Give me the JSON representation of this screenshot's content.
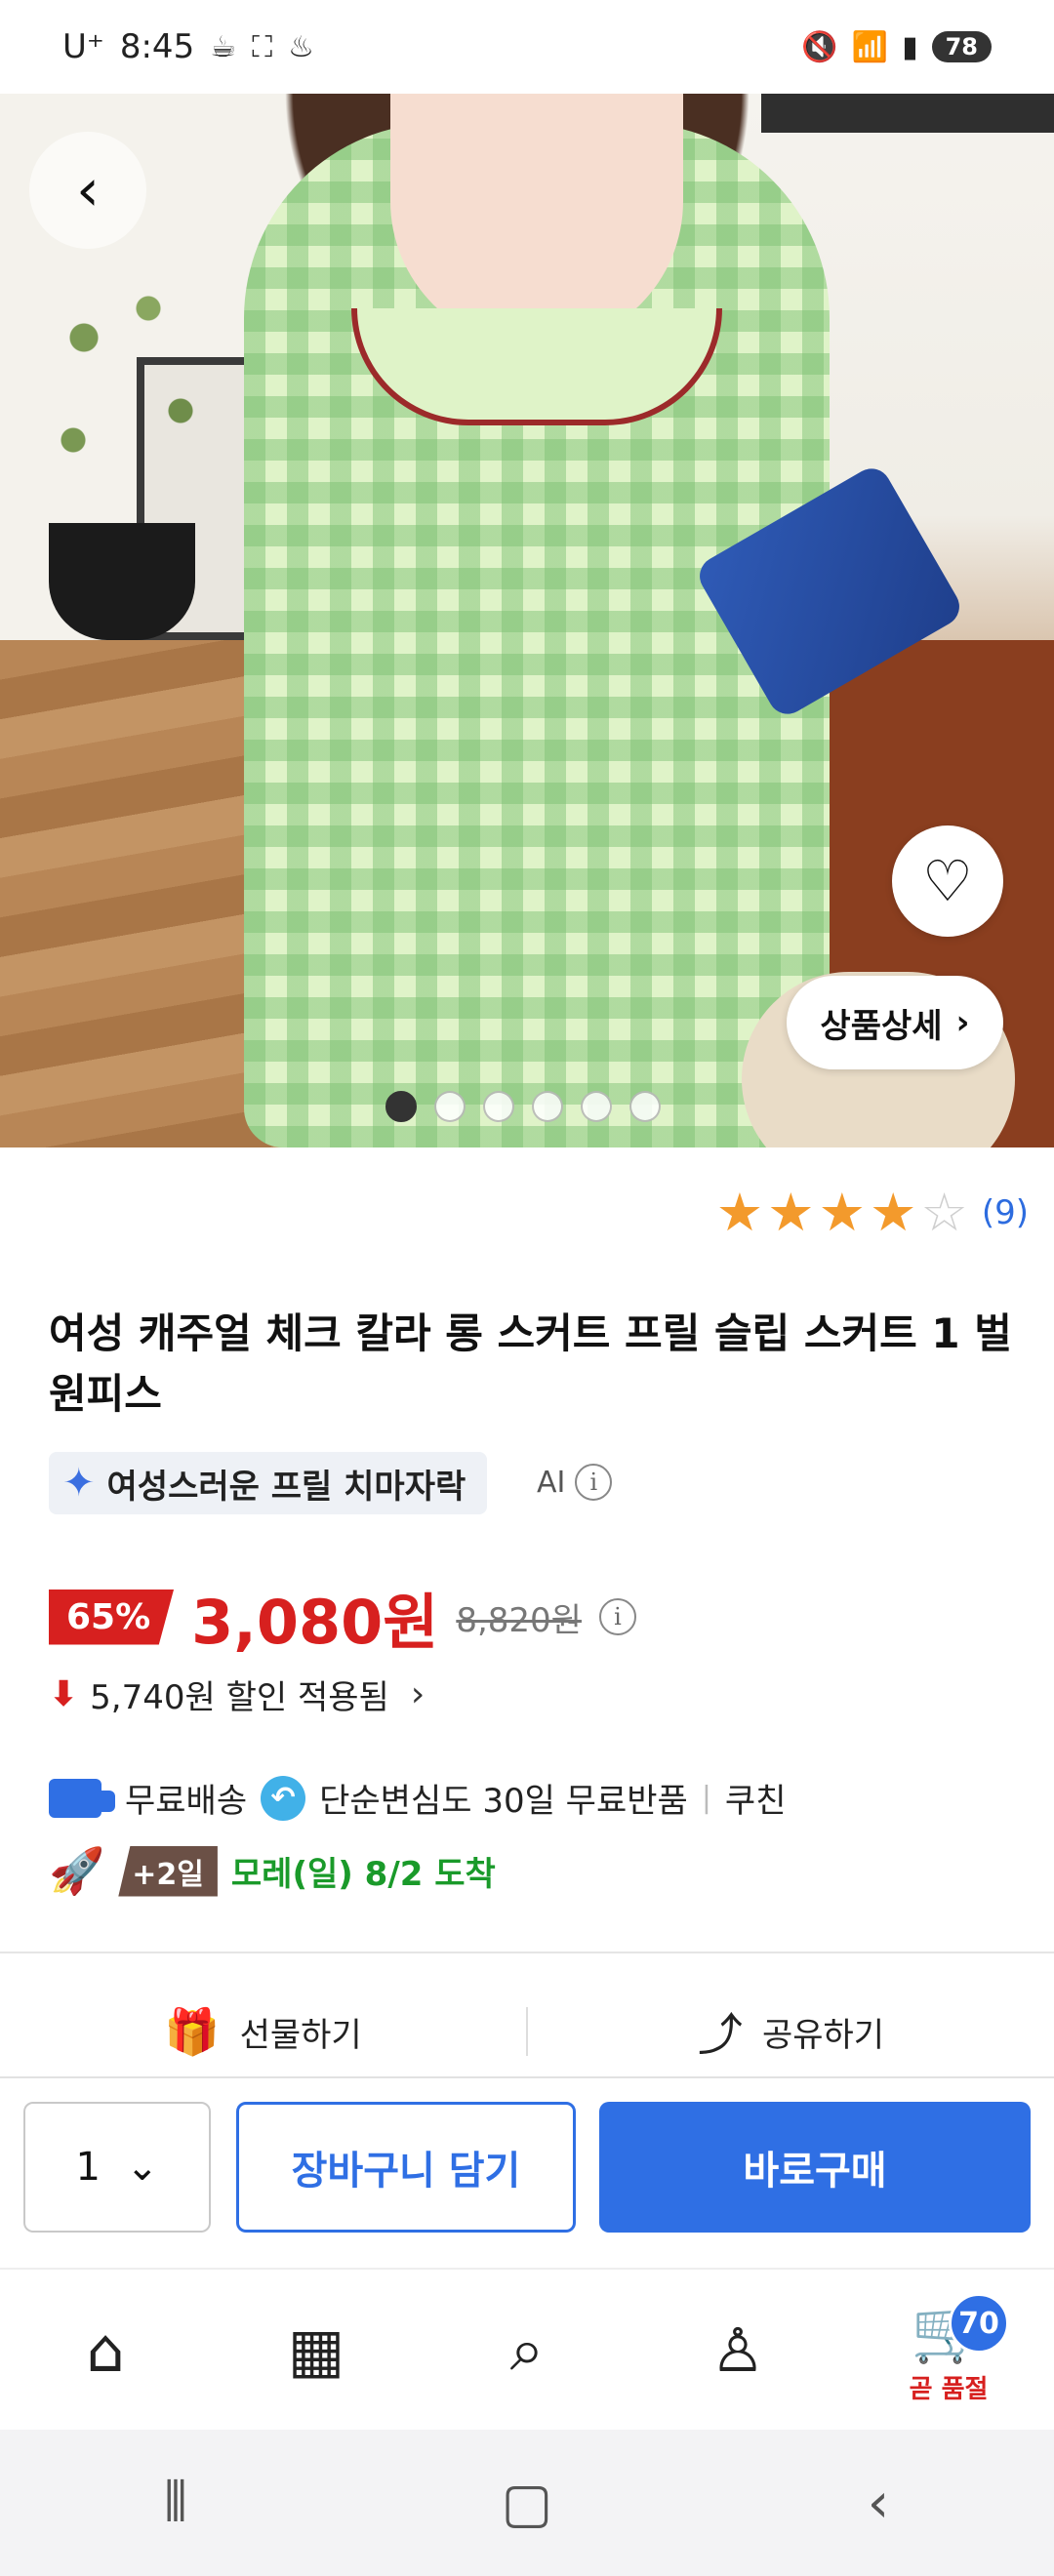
{
  "status_bar": {
    "carrier": "U⁺",
    "time": "8:45",
    "battery": "78",
    "icons": [
      "coffee-cup-icon",
      "screenshot-icon",
      "noodle-bowl-icon",
      "mute-icon",
      "wifi-icon",
      "signal-icon"
    ]
  },
  "hero": {
    "detail_label": "상품상세",
    "image_count": 6,
    "active_index": 0
  },
  "rating": {
    "stars": 4,
    "max_stars": 5,
    "count": "(9)"
  },
  "product": {
    "title": "여성 캐주얼 체크 칼라 롱 스커트 프릴 슬립 스커트 1 벌 원피스",
    "ai_tag": "여성스러운 프릴 치마자락",
    "ai_label": "AI"
  },
  "price": {
    "discount_pct": "65%",
    "sale_price": "3,080원",
    "original_price": "8,820원",
    "discount_applied": "5,740원 할인 적용됨"
  },
  "shipping": {
    "free_shipping": "무료배송",
    "free_return": "단순변심도 30일 무료반품",
    "seller": "쿠친",
    "extra_days": "+2일",
    "arrival": "모레(일) 8/2 도착"
  },
  "actions": {
    "gift": "선물하기",
    "share": "공유하기"
  },
  "buy_bar": {
    "quantity": "1",
    "add_to_cart": "장바구니 담기",
    "buy_now": "바로구매"
  },
  "bottom_nav": {
    "cart_count": "70",
    "cart_status": "곧 품절"
  },
  "colors": {
    "accent_blue": "#2f6fe4",
    "sale_red": "#d7201f",
    "star_orange": "#f39a2c",
    "arrival_green": "#1a9a2a"
  }
}
